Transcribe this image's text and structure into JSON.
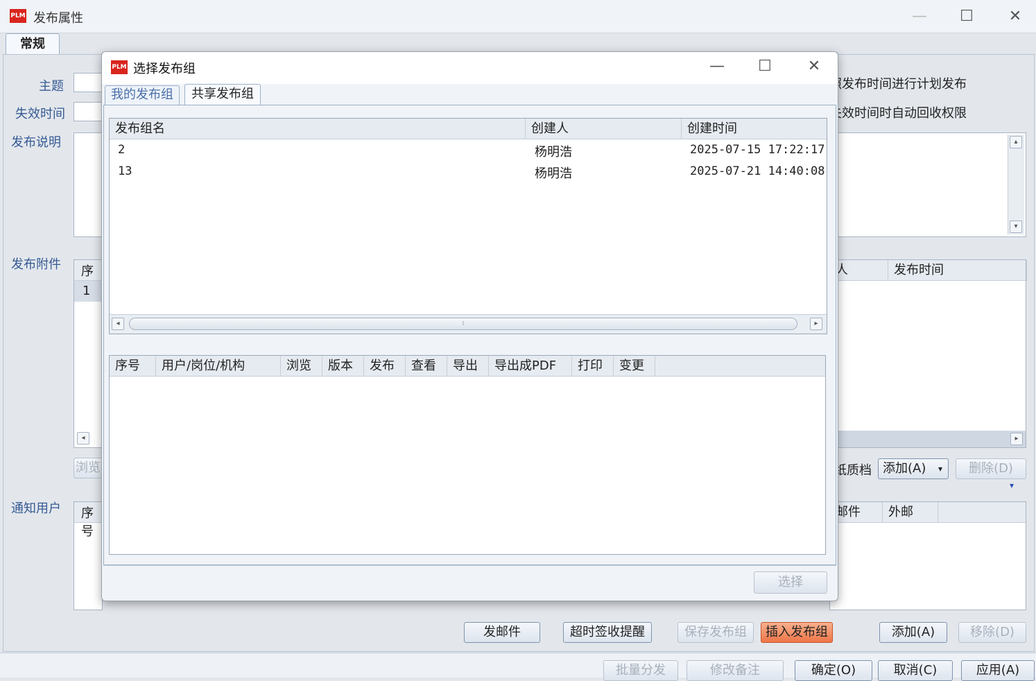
{
  "window": {
    "title": "发布属性",
    "tab": "常规"
  },
  "form": {
    "subject_label": "主题",
    "expire_label": "失效时间",
    "desc_label": "发布说明",
    "attach_label": "发布附件",
    "notify_label": "通知用户",
    "schedule_option": "照发布时间进行计划发布",
    "revoke_option": "失效时间时自动回收权限",
    "paper_label": "纸质档",
    "add_dropdown": "添加(A)",
    "delete_button": "删除(D)",
    "browse_button": "浏览"
  },
  "attach_table": {
    "col_seq": "序号",
    "col_creator": "人",
    "col_pubtime": "发布时间",
    "row1_seq": "1"
  },
  "notify_table": {
    "col_seq": "序号",
    "col_mail": "邮件",
    "col_extmail": "外邮"
  },
  "bottom_buttons": {
    "send_mail": "发邮件",
    "overtime_remind": "超时签收提醒",
    "save_group": "保存发布组",
    "insert_group": "插入发布组",
    "add": "添加(A)",
    "remove": "移除(D)"
  },
  "footer_buttons": {
    "batch_dist": "批量分发",
    "edit_note": "修改备注",
    "ok": "确定(O)",
    "cancel": "取消(C)",
    "apply": "应用(A)"
  },
  "dialog": {
    "title": "选择发布组",
    "tabs": [
      "我的发布组",
      "共享发布组"
    ],
    "groups_table": {
      "headers": [
        "发布组名",
        "创建人",
        "创建时间"
      ],
      "rows": [
        {
          "name": "2",
          "creator": "杨明浩",
          "created": "2025-07-15 17:22:17"
        },
        {
          "name": "13",
          "creator": "杨明浩",
          "created": "2025-07-21 14:40:08"
        }
      ]
    },
    "perm_table": {
      "headers": [
        "序号",
        "用户/岗位/机构",
        "浏览",
        "版本",
        "发布",
        "查看",
        "导出",
        "导出成PDF",
        "打印",
        "变更"
      ]
    },
    "select_button": "选择"
  },
  "icons": {
    "logo": "PLM",
    "minimize": "—",
    "maximize": "☐",
    "close": "✕"
  },
  "colors": {
    "accent_label": "#365a93",
    "hot_button": "#ee7547",
    "logo_red": "#d9251d"
  }
}
